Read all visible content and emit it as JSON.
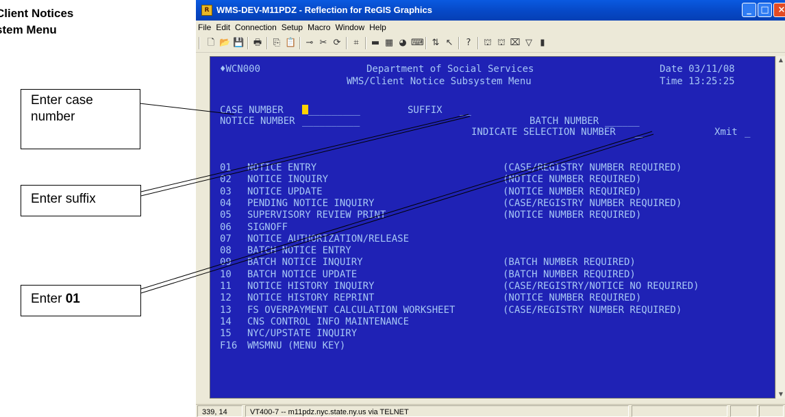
{
  "heading": "Client Notices\nstem Menu",
  "callouts": {
    "case": "Enter case number",
    "suffix": "Enter suffix",
    "enter_prefix": "Enter ",
    "enter_value": "01"
  },
  "window": {
    "title": "WMS-DEV-M11PDZ - Reflection for ReGIS Graphics",
    "menu": [
      "File",
      "Edit",
      "Connection",
      "Setup",
      "Macro",
      "Window",
      "Help"
    ],
    "toolbar_icons": [
      "new-icon",
      "open-icon",
      "save-icon",
      "print-icon",
      "copy-icon",
      "paste-icon",
      "connect-icon",
      "disconnect-icon",
      "reconnect-icon",
      "capture-icon",
      "display-icon",
      "setup-icon",
      "color-icon",
      "keyboard-icon",
      "transfer-icon",
      "mouse-icon",
      "help-icon",
      "macro-record-icon",
      "macro-run-icon",
      "hotspot-icon",
      "stop-icon",
      "exit-icon"
    ]
  },
  "terminal": {
    "screen_id": "WCN000",
    "dept": "Department of Social Services",
    "subtitle": "WMS/Client Notice Subsystem Menu",
    "date_label": "Date",
    "date": "03/11/08",
    "time_label": "Time",
    "time": "13:25:25",
    "case_label": "CASE NUMBER",
    "case_field": "_________",
    "suffix_label": "SUFFIX",
    "suffix_field": "__",
    "notice_label": "NOTICE NUMBER",
    "notice_field": "__________",
    "batch_label": "BATCH NUMBER",
    "batch_field": "______",
    "indicate_label": "INDICATE SELECTION NUMBER",
    "indicate_field": "__",
    "xmit_label": "Xmit",
    "xmit_field": "_",
    "options": [
      {
        "num": "01",
        "label": "NOTICE ENTRY",
        "req": "(CASE/REGISTRY NUMBER REQUIRED)"
      },
      {
        "num": "02",
        "label": "NOTICE INQUIRY",
        "req": "(NOTICE NUMBER REQUIRED)"
      },
      {
        "num": "03",
        "label": "NOTICE UPDATE",
        "req": "(NOTICE NUMBER REQUIRED)"
      },
      {
        "num": "04",
        "label": "PENDING NOTICE INQUIRY",
        "req": "(CASE/REGISTRY NUMBER REQUIRED)"
      },
      {
        "num": "05",
        "label": "SUPERVISORY REVIEW PRINT",
        "req": "(NOTICE NUMBER REQUIRED)"
      },
      {
        "num": "06",
        "label": "SIGNOFF",
        "req": ""
      },
      {
        "num": "07",
        "label": "NOTICE AUTHORIZATION/RELEASE",
        "req": ""
      },
      {
        "num": "08",
        "label": "BATCH NOTICE ENTRY",
        "req": ""
      },
      {
        "num": "09",
        "label": "BATCH NOTICE INQUIRY",
        "req": "(BATCH NUMBER REQUIRED)"
      },
      {
        "num": "10",
        "label": "BATCH NOTICE UPDATE",
        "req": "(BATCH NUMBER REQUIRED)"
      },
      {
        "num": "11",
        "label": "NOTICE HISTORY INQUIRY",
        "req": "(CASE/REGISTRY/NOTICE NO REQUIRED)"
      },
      {
        "num": "12",
        "label": "NOTICE HISTORY REPRINT",
        "req": "(NOTICE NUMBER REQUIRED)"
      },
      {
        "num": "13",
        "label": "FS OVERPAYMENT CALCULATION WORKSHEET",
        "req": "(CASE/REGISTRY NUMBER REQUIRED)"
      },
      {
        "num": "14",
        "label": "CNS CONTROL INFO MAINTENANCE",
        "req": ""
      },
      {
        "num": "15",
        "label": "NYC/UPSTATE INQUIRY",
        "req": ""
      },
      {
        "num": "F16",
        "label": "WMSMNU (MENU KEY)",
        "req": ""
      }
    ]
  },
  "status": {
    "cursor_pos": "339, 14",
    "connection": "VT400-7 -- m11pdz.nyc.state.ny.us via TELNET"
  },
  "colors": {
    "terminal_bg": "#1f22b5",
    "terminal_text": "#a7c8f5",
    "cursor": "#ffd200",
    "titlebar": "#0648c6"
  }
}
